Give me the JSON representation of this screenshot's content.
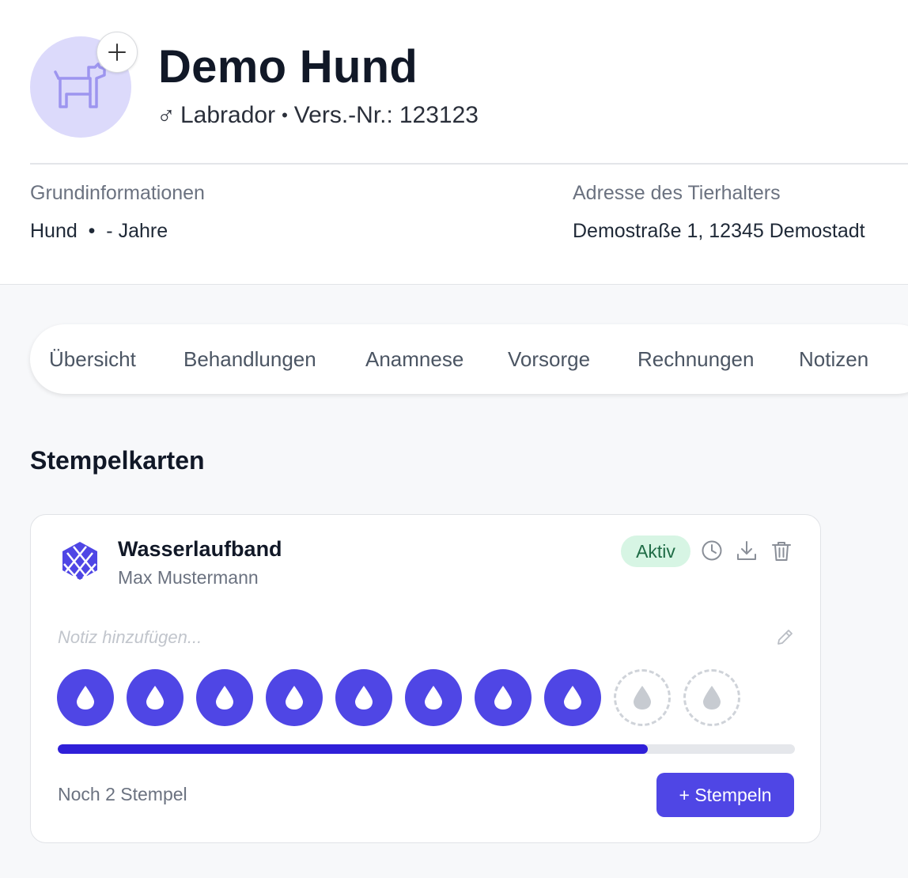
{
  "patient": {
    "name": "Demo Hund",
    "sex_symbol": "♂",
    "breed": "Labrador",
    "separator": "•",
    "insurance_label": "Vers.-Nr.:",
    "insurance_number": "123123",
    "avatar_icon": "dog-icon",
    "avatar_add_icon": "plus-icon"
  },
  "info": {
    "basic_label": "Grundinformationen",
    "basic_value": "Hund  •  - Jahre",
    "address_label": "Adresse des Tierhalters",
    "address_value": "Demostraße 1, 12345 Demostadt"
  },
  "tabs": [
    {
      "label": "Übersicht"
    },
    {
      "label": "Behandlungen"
    },
    {
      "label": "Anamnese"
    },
    {
      "label": "Vorsorge"
    },
    {
      "label": "Rechnungen"
    },
    {
      "label": "Notizen"
    }
  ],
  "section": {
    "title": "Stempelkarten"
  },
  "stamp_card": {
    "title": "Wasserlaufband",
    "owner": "Max Mustermann",
    "status": "Aktiv",
    "note_placeholder": "Notiz hinzufügen...",
    "stamps_total": 10,
    "stamps_filled": 8,
    "stamp_icon": "water-drop-icon",
    "progress_fraction": 0.8,
    "remaining_text": "Noch 2 Stempel",
    "stamp_button": "+ Stempeln",
    "actions": [
      "history-icon",
      "download-icon",
      "trash-icon"
    ]
  },
  "colors": {
    "accent": "#4f46e5",
    "progress": "#2f1fd8",
    "badge_bg": "#d7f5e4",
    "badge_text": "#1e6b45",
    "avatar_bg": "#dcdafb"
  }
}
